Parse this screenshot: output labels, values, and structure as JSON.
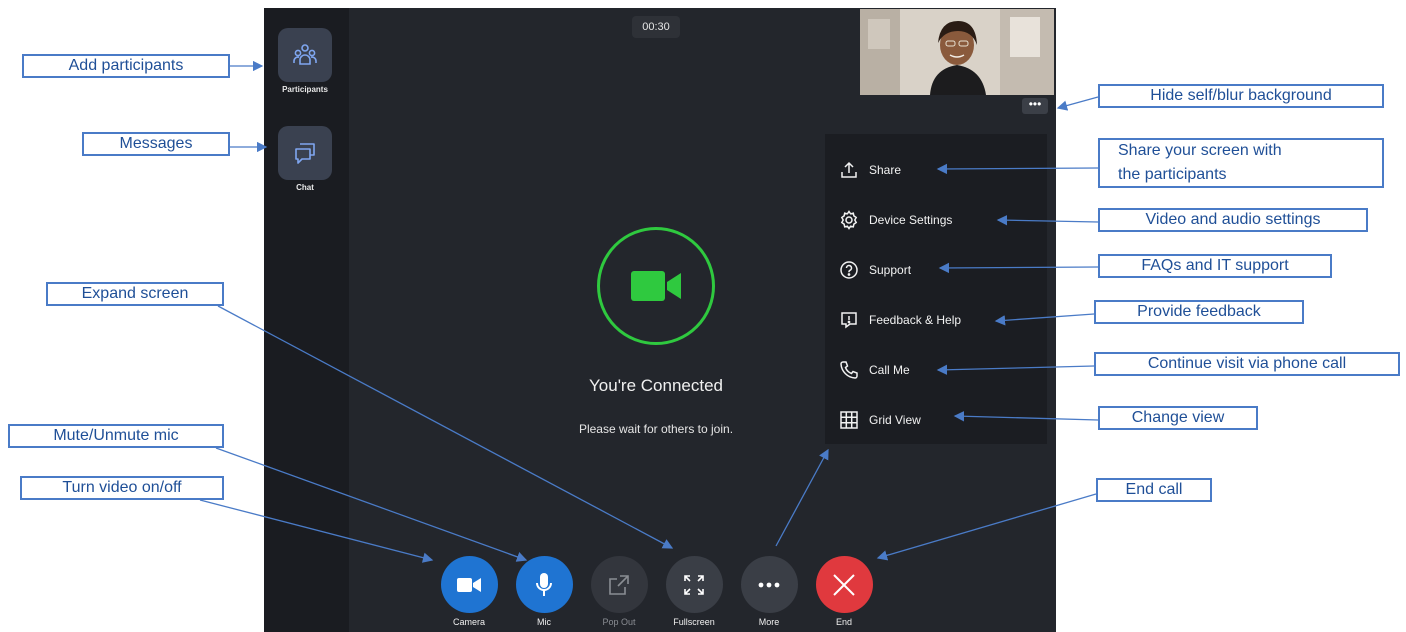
{
  "timer": "00:30",
  "sidebar": {
    "participants_label": "Participants",
    "chat_label": "Chat"
  },
  "self_view": {
    "more_label": "•••"
  },
  "status": {
    "title": "You're Connected",
    "subtitle": "Please wait for others to join."
  },
  "menu": [
    {
      "label": "Share",
      "icon": "share-icon"
    },
    {
      "label": "Device Settings",
      "icon": "gear-icon"
    },
    {
      "label": "Support",
      "icon": "question-icon"
    },
    {
      "label": "Feedback & Help",
      "icon": "feedback-icon"
    },
    {
      "label": "Call Me",
      "icon": "phone-icon"
    },
    {
      "label": "Grid View",
      "icon": "grid-icon"
    }
  ],
  "controls": [
    {
      "label": "Camera",
      "icon": "camera-icon",
      "color": "#1f74d2"
    },
    {
      "label": "Mic",
      "icon": "mic-icon",
      "color": "#1f74d2"
    },
    {
      "label": "Pop Out",
      "icon": "pop-out-icon",
      "color": "#33363d"
    },
    {
      "label": "Fullscreen",
      "icon": "fullscreen-icon",
      "color": "#3a3e46"
    },
    {
      "label": "More",
      "icon": "more-icon",
      "color": "#3a3e46"
    },
    {
      "label": "End",
      "icon": "close-icon",
      "color": "#e0393e"
    }
  ],
  "callouts": {
    "add_participants": "Add participants",
    "messages": "Messages",
    "expand_screen": "Expand screen",
    "mute_mic": "Mute/Unmute mic",
    "turn_video": "Turn video on/off",
    "hide_self": "Hide self/blur background",
    "share_line1": "Share your screen with",
    "share_line2": "the participants",
    "video_audio": "Video and audio settings",
    "faqs": "FAQs and IT support",
    "feedback": "Provide feedback",
    "phone_call": "Continue visit via phone call",
    "change_view": "Change view",
    "end_call": "End call"
  },
  "colors": {
    "accent_green": "#2fc93f",
    "primary_blue": "#1f74d2",
    "end_red": "#e0393e",
    "callout_blue": "#4a7bc7"
  }
}
